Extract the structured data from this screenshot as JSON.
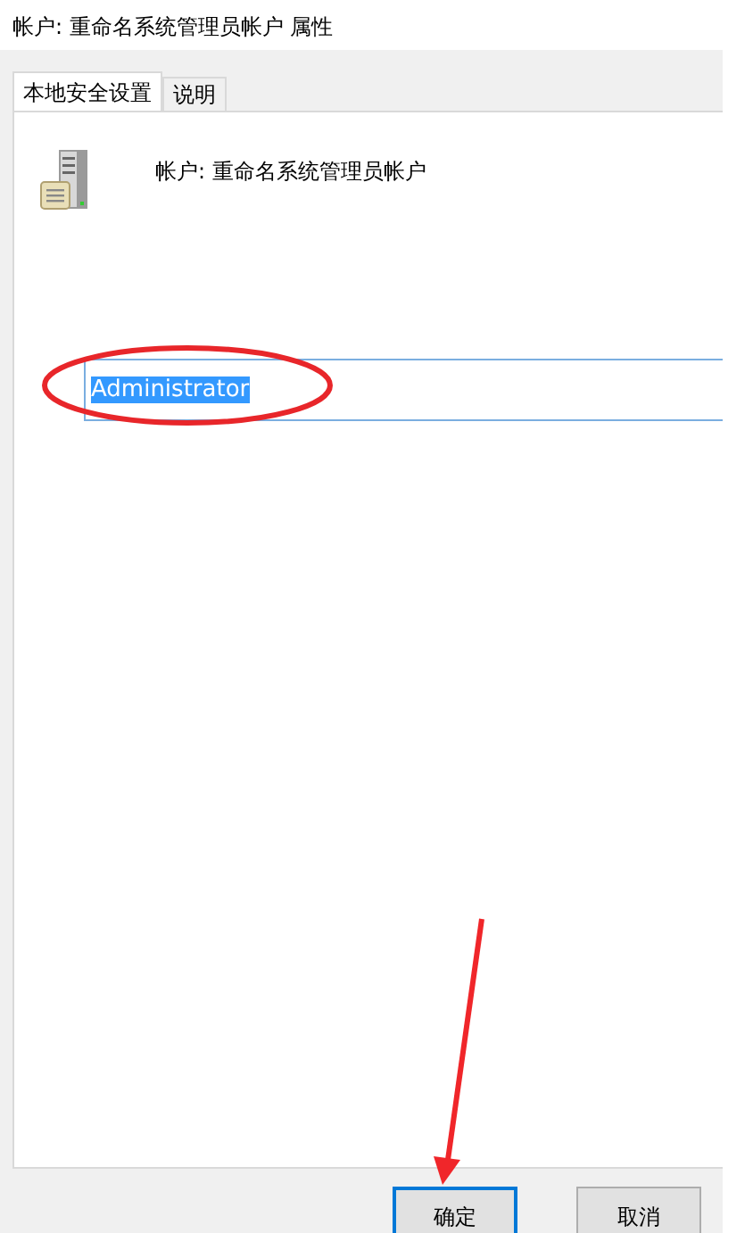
{
  "window": {
    "title": "帐户: 重命名系统管理员帐户 属性"
  },
  "tabs": [
    {
      "label": "本地安全设置",
      "selected": true
    },
    {
      "label": "说明",
      "selected": false
    }
  ],
  "policy": {
    "title": "帐户: 重命名系统管理员帐户"
  },
  "field": {
    "value": "Administrator",
    "text_selected": true
  },
  "buttons": [
    {
      "label": "确定",
      "default": true
    },
    {
      "label": "取消",
      "default": false
    }
  ],
  "annotations": [
    {
      "kind": "ellipse",
      "color": "#e8262a"
    },
    {
      "kind": "arrow",
      "color": "#f0262a"
    }
  ]
}
